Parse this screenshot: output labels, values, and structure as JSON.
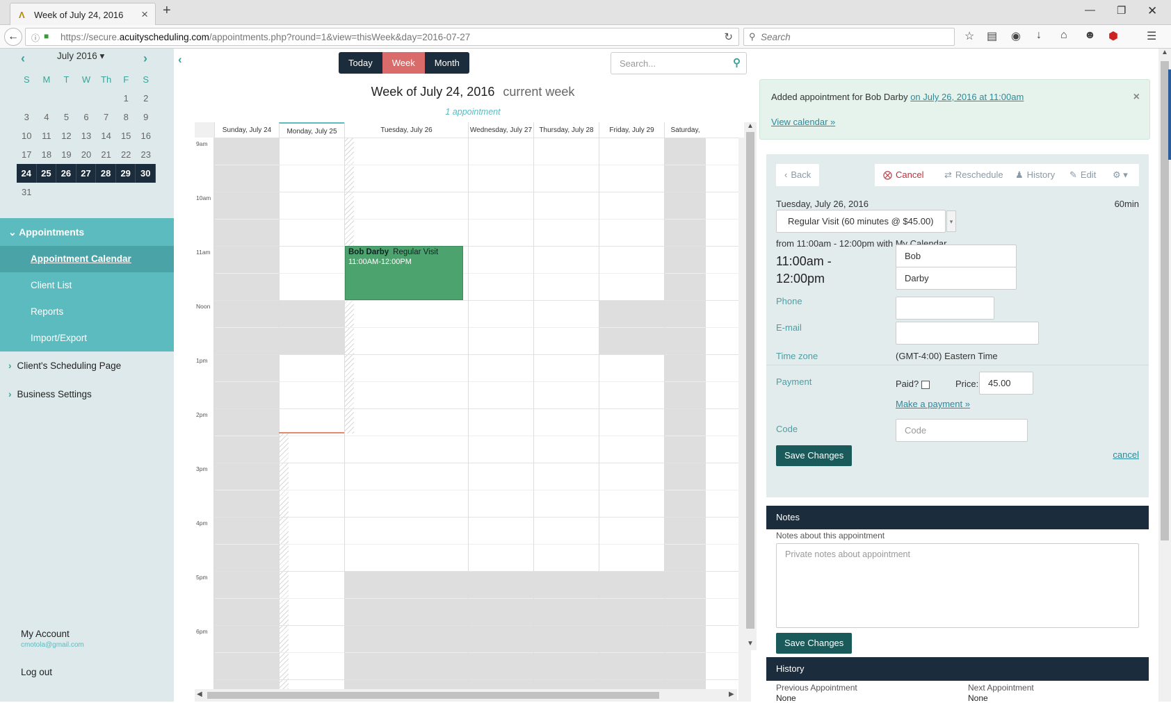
{
  "browser": {
    "tab_title": "Week of July 24, 2016",
    "url_prefix": "https://secure.",
    "url_domain": "acuityscheduling.com",
    "url_path": "/appointments.php?round=1&view=thisWeek&day=2016-07-27",
    "search_placeholder": "Search"
  },
  "mini_calendar": {
    "month": "July 2016",
    "dow": [
      "S",
      "M",
      "T",
      "W",
      "Th",
      "F",
      "S"
    ],
    "weeks": [
      [
        "",
        "",
        "",
        "",
        "",
        "1",
        "2"
      ],
      [
        "3",
        "4",
        "5",
        "6",
        "7",
        "8",
        "9"
      ],
      [
        "10",
        "11",
        "12",
        "13",
        "14",
        "15",
        "16"
      ],
      [
        "17",
        "18",
        "19",
        "20",
        "21",
        "22",
        "23"
      ],
      [
        "24",
        "25",
        "26",
        "27",
        "28",
        "29",
        "30"
      ],
      [
        "31",
        "",
        "",
        "",
        "",
        "",
        ""
      ]
    ]
  },
  "sidebar": {
    "section": "Appointments",
    "items": [
      "Appointment Calendar",
      "Client List",
      "Reports",
      "Import/Export"
    ],
    "top_items": [
      "Client's Scheduling Page",
      "Business Settings"
    ],
    "account": "My Account",
    "email": "cmotola@gmail.com",
    "logout": "Log out"
  },
  "calendar": {
    "views": [
      "Today",
      "Week",
      "Month"
    ],
    "active_view": "Week",
    "search_placeholder": "Search...",
    "week_title": "Week of July 24, 2016",
    "current_label": "current week",
    "appointment_count": "1 appointment",
    "days": [
      "Sunday, July 24",
      "Monday, July 25",
      "Tuesday, July 26",
      "Wednesday, July 27",
      "Thursday, July 28",
      "Friday, July 29",
      "Saturday,"
    ],
    "times": [
      "9am",
      "10am",
      "11am",
      "Noon",
      "1pm",
      "2pm",
      "3pm",
      "4pm",
      "5pm",
      "6pm"
    ],
    "event": {
      "client": "Bob Darby",
      "service": "Regular Visit",
      "time": "11:00AM-12:00PM"
    }
  },
  "alert": {
    "message": "Added appointment for Bob Darby",
    "link": "on July 26, 2016 at 11:00am",
    "view_link": "View calendar »"
  },
  "detail": {
    "toolbar": {
      "back": "Back",
      "cancel": "Cancel",
      "reschedule": "Reschedule",
      "history": "History",
      "edit": "Edit"
    },
    "date": "Tuesday, July 26, 2016",
    "duration": "60min",
    "service": "Regular Visit (60 minutes @ $45.00)",
    "from_text": "from 11:00am - 12:00pm with My Calendar",
    "time_range": "11:00am - 12:00pm",
    "first_name": "Bob",
    "last_name": "Darby",
    "phone_label": "Phone",
    "email_label": "E-mail",
    "timezone_label": "Time zone",
    "timezone": "(GMT-4:00) Eastern Time",
    "payment_label": "Payment",
    "paid_label": "Paid?",
    "price_label": "Price: $",
    "price": "45.00",
    "make_payment": "Make a payment »",
    "code_label": "Code",
    "code_placeholder": "Code",
    "save": "Save Changes",
    "cancel_link": "cancel"
  },
  "notes": {
    "header": "Notes",
    "label": "Notes about this appointment",
    "placeholder": "Private notes about appointment",
    "save": "Save Changes"
  },
  "history": {
    "header": "History",
    "prev_label": "Previous Appointment",
    "next_label": "Next Appointment",
    "prev_value": "None",
    "next_value": "None"
  },
  "colors": {
    "accent": "#5bbbbf",
    "dark": "#1b2c3c",
    "event": "#4ca36e",
    "week_active": "#d96b6b"
  }
}
